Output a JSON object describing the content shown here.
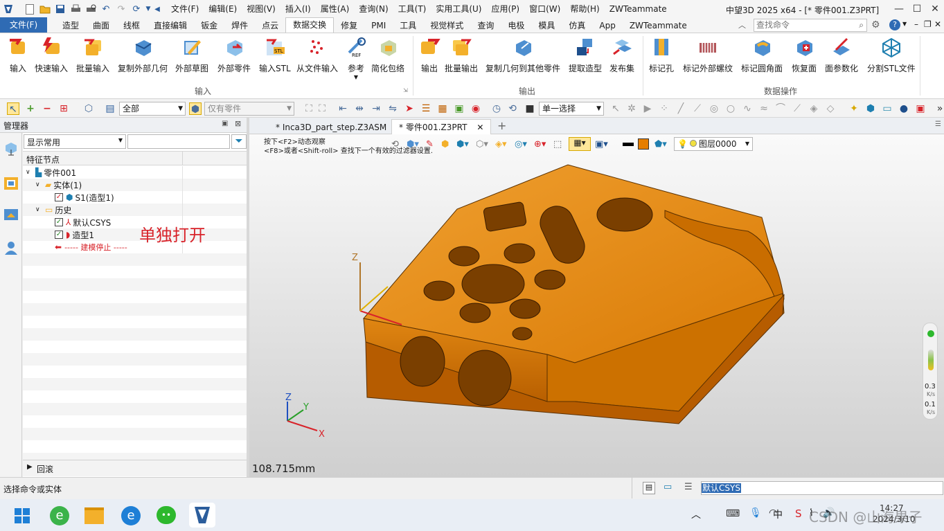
{
  "title_bar": {
    "menus": [
      "文件(F)",
      "编辑(E)",
      "视图(V)",
      "插入(I)",
      "属性(A)",
      "查询(N)",
      "工具(T)",
      "实用工具(U)",
      "应用(P)",
      "窗口(W)",
      "帮助(H)",
      "ZWTeammate"
    ],
    "window_title": "中望3D 2025 x64 - [* 零件001.Z3PRT]"
  },
  "ribbon_tabs": [
    "文件(F)",
    "造型",
    "曲面",
    "线框",
    "直接编辑",
    "钣金",
    "焊件",
    "点云",
    "数据交换",
    "修复",
    "PMI",
    "工具",
    "视觉样式",
    "查询",
    "电极",
    "模具",
    "仿真",
    "App",
    "ZWTeammate"
  ],
  "active_tab": "数据交换",
  "search": {
    "placeholder": "查找命令"
  },
  "ribbon": {
    "input_buttons": [
      "输入",
      "快速输入",
      "批量输入",
      "复制外部几何",
      "外部草图",
      "外部零件",
      "输入STL",
      "从文件输入",
      "参考",
      "简化包络"
    ],
    "output_buttons": [
      "输出",
      "批量输出",
      "复制几何到其他零件",
      "提取造型",
      "发布集"
    ],
    "dataops_buttons": [
      "标记孔",
      "标记外部螺纹",
      "标记圆角面",
      "恢复面",
      "面参数化",
      "分割STL文件"
    ],
    "group_input": "输入",
    "group_output": "输出",
    "group_dataops": "数据操作"
  },
  "toolbar": {
    "filter_all": "全部",
    "filter_part": "仅有零件",
    "select_mode": "单一选择"
  },
  "manager": {
    "title": "管理器",
    "display_combo": "显示常用",
    "column_header": "特征节点",
    "tree": {
      "root": "零件001",
      "solid": "实体(1)",
      "s1": "S1(造型1)",
      "history": "历史",
      "csys": "默认CSYS",
      "shape1": "造型1",
      "stop": "----- 建模停止 -----"
    },
    "annotation": "单独打开",
    "rollback": "回滚"
  },
  "doc_tabs": [
    "* Inca3D_part_step.Z3ASM",
    "* 零件001.Z3PRT"
  ],
  "viewport": {
    "hint1": "按下<F2>动态观察",
    "hint2": "<F8>或者<Shift-roll> 查找下一个有效的过滤器设置.",
    "layer": "图层0000",
    "scale": "108.715mm",
    "speed1": "0.3",
    "speed2": "0.1",
    "speed_unit": "K/s",
    "part_color": "#e6890e"
  },
  "status": {
    "prompt": "选择命令或实体",
    "field_value": "默认CSYS"
  },
  "taskbar": {
    "time": "14:27",
    "date": "2024/3/10",
    "watermark": "CSDN @山海果子"
  }
}
